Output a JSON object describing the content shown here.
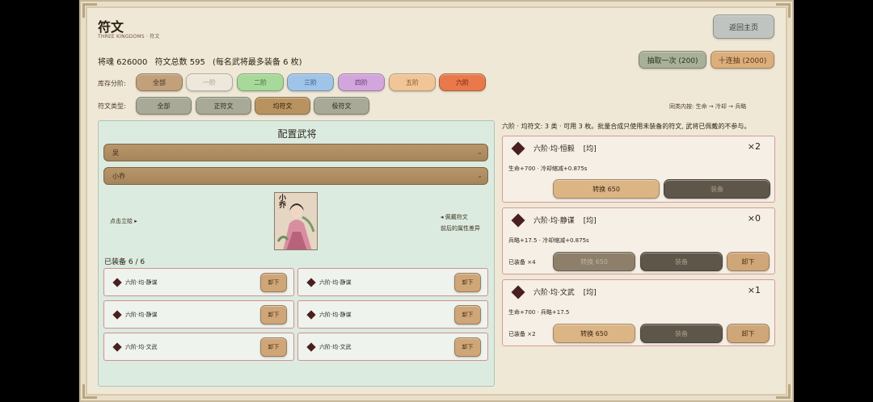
{
  "header": {
    "title": "符文",
    "subtitle": "THREE KINGDOMS · 符文",
    "home_label": "返回主页"
  },
  "stats": {
    "soul_label": "将魂 626000",
    "total_label": "符文总数 595",
    "note": "(每名武将最多装备 6 枚)"
  },
  "draw": {
    "single_label": "抽取一次 (200)",
    "ten_label": "十连抽 (2000)"
  },
  "filters": {
    "tier_label": "库存分阶:",
    "tiers": [
      {
        "label": "全部",
        "color": "#c2a07a"
      },
      {
        "label": "一阶",
        "color": "#eee8dc"
      },
      {
        "label": "二阶",
        "color": "#a7d99a"
      },
      {
        "label": "三阶",
        "color": "#9fc4e8"
      },
      {
        "label": "四阶",
        "color": "#d2a6dc"
      },
      {
        "label": "五阶",
        "color": "#f0c699"
      },
      {
        "label": "六阶",
        "color": "#e9784b"
      }
    ],
    "type_label": "符文类型:",
    "types": [
      "全部",
      "正符文",
      "均符文",
      "极符文"
    ],
    "order_note": "同类内按: 生命 → 冷却 → 兵略"
  },
  "config": {
    "title": "配置武将",
    "select_camp": "吴",
    "select_general": "小乔",
    "portrait_caption": "小乔",
    "hint_left": "点击立绘 ▸",
    "hint_right_1": "◂ 佩戴符文",
    "hint_right_2": "前后的属性差异",
    "equipped_title": "已装备 6 / 6",
    "unequip_label": "卸下",
    "slots": [
      "六阶·均·静谋",
      "六阶·均·静谋",
      "六阶·均·静谋",
      "六阶·均·静谋",
      "六阶·均·文武",
      "六阶·均·文武"
    ]
  },
  "runes": {
    "description": "六阶 · 均符文: 3 类 · 可用 3 枚。批量合成只使用未装备的符文, 武将已佩戴的不参与。",
    "cards": [
      {
        "name": "六阶·均·恒毅",
        "tag": "[均]",
        "count": "×2",
        "attr": "生命+700 · 冷却缩减+0.875s",
        "equipped": "",
        "convert": "转换 650",
        "equip": "装备",
        "unequip": ""
      },
      {
        "name": "六阶·均·静谋",
        "tag": "[均]",
        "count": "×0",
        "attr": "兵略+17.5 · 冷却缩减+0.875s",
        "equipped": "已装备 ×4",
        "convert": "转换 650",
        "equip": "装备",
        "unequip": "卸下"
      },
      {
        "name": "六阶·均·文武",
        "tag": "[均]",
        "count": "×1",
        "attr": "生命+700 · 兵略+17.5",
        "equipped": "已装备 ×2",
        "convert": "转换 650",
        "equip": "装备",
        "unequip": "卸下"
      }
    ]
  }
}
